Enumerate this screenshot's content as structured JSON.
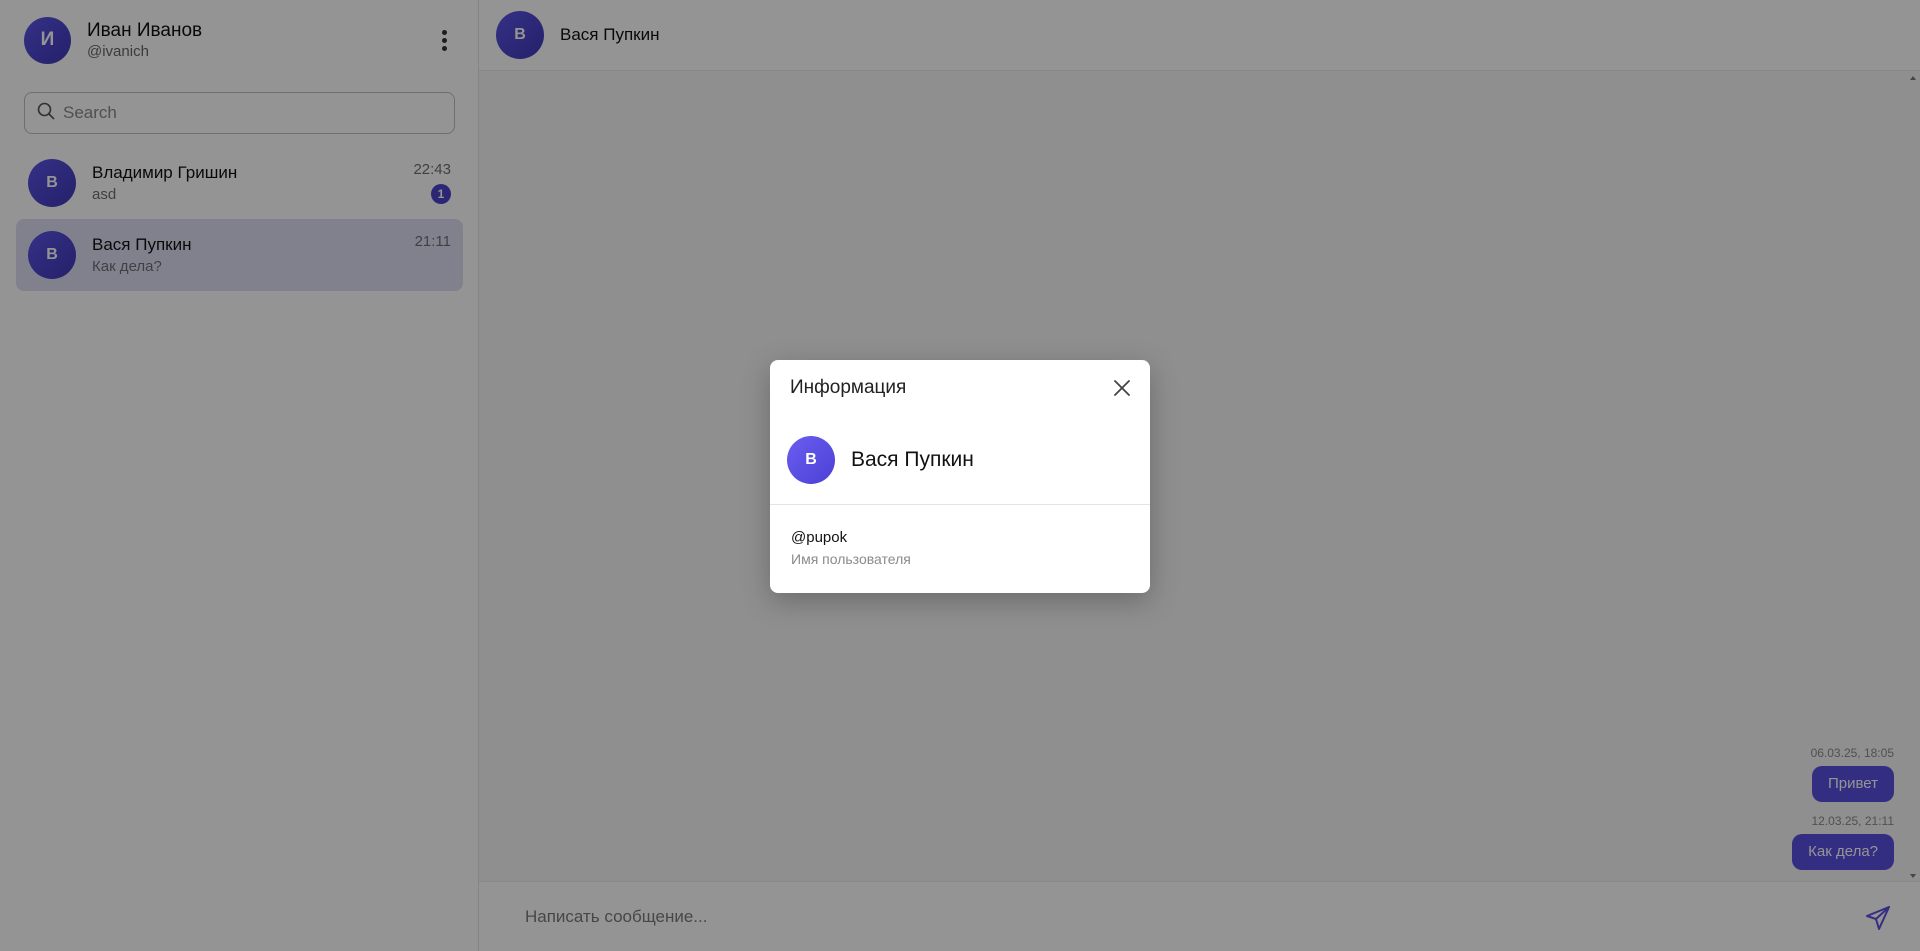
{
  "profile": {
    "avatar_letter": "И",
    "name": "Иван Иванов",
    "username": "@ivanich"
  },
  "search": {
    "placeholder": "Search"
  },
  "chats": [
    {
      "avatar_letter": "В",
      "name": "Владимир Гришин",
      "last_message": "asd",
      "time": "22:43",
      "unread": "1",
      "active": false
    },
    {
      "avatar_letter": "В",
      "name": "Вася Пупкин",
      "last_message": "Как дела?",
      "time": "21:11",
      "active": true
    }
  ],
  "chat_header": {
    "avatar_letter": "В",
    "title": "Вася Пупкин"
  },
  "messages": [
    {
      "time": "06.03.25, 18:05",
      "text": "Привет"
    },
    {
      "time": "12.03.25, 21:11",
      "text": "Как дела?"
    }
  ],
  "composer": {
    "placeholder": "Написать сообщение..."
  },
  "modal": {
    "title": "Информация",
    "avatar_letter": "В",
    "user_name": "Вася Пупкин",
    "username_value": "@pupok",
    "username_label": "Имя пользователя"
  },
  "colors": {
    "accent": "#5850e0",
    "badge": "#4b44c9",
    "active_chat_bg": "#dedff5",
    "overlay": "rgba(0,0,0,0.42)"
  }
}
